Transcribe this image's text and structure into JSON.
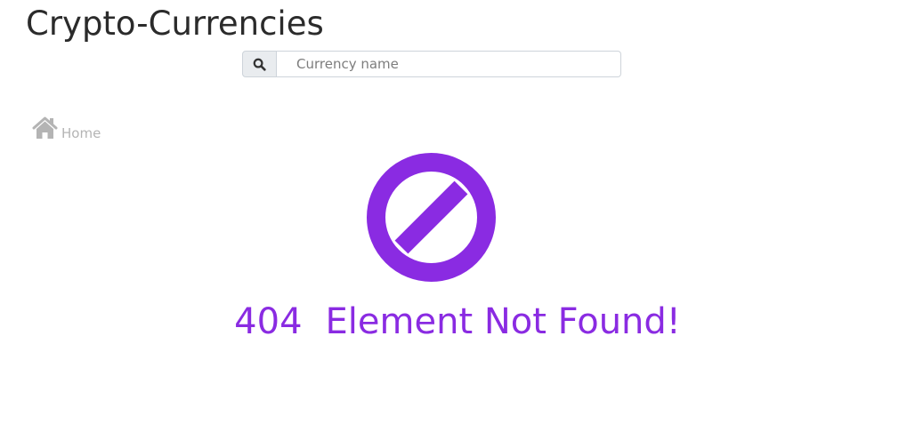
{
  "header": {
    "title": "Crypto-Currencies"
  },
  "search": {
    "icon": "search-icon",
    "placeholder": "Currency name",
    "value": ""
  },
  "nav": {
    "home_icon": "home-icon",
    "home_label": "Home"
  },
  "error": {
    "icon": "no-entry-icon",
    "code": "404",
    "message": "Element Not Found!"
  },
  "colors": {
    "accent": "#8a2be2",
    "title": "#2b2b2b",
    "muted": "#b4b4b4",
    "addon_bg": "#e9ecef",
    "border": "#ced4da"
  }
}
